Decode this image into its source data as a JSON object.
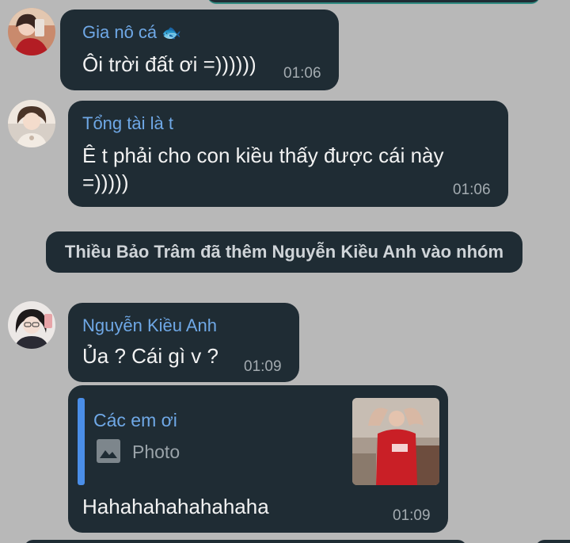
{
  "messages": [
    {
      "sender": "Gia nô cá",
      "sender_emoji": "🐟",
      "text": "Ôi trời đất ơi =))))))",
      "time": "01:06"
    },
    {
      "sender": "Tổng tài là t",
      "text_line1": "Ê t phải cho con kiều thấy được cái này",
      "text_line2": "=)))))",
      "time": "01:06"
    },
    {
      "sender": "Nguyễn Kiều Anh",
      "text": "Ủa ? Cái gì v ?",
      "time": "01:09"
    },
    {
      "reply_title": "Các em ơi",
      "reply_photo_label": "Photo",
      "text": "Hahahahahahahaha",
      "time": "01:09"
    }
  ],
  "system_message": "Thiều Bảo Trâm đã thêm Nguyễn Kiều Anh vào nhóm",
  "colors": {
    "background": "#b8b8b8",
    "bubble": "#1f2c34",
    "sender_name": "#6fa8e6",
    "reply_bar": "#4a8ee8",
    "timestamp": "#a3abb0"
  }
}
